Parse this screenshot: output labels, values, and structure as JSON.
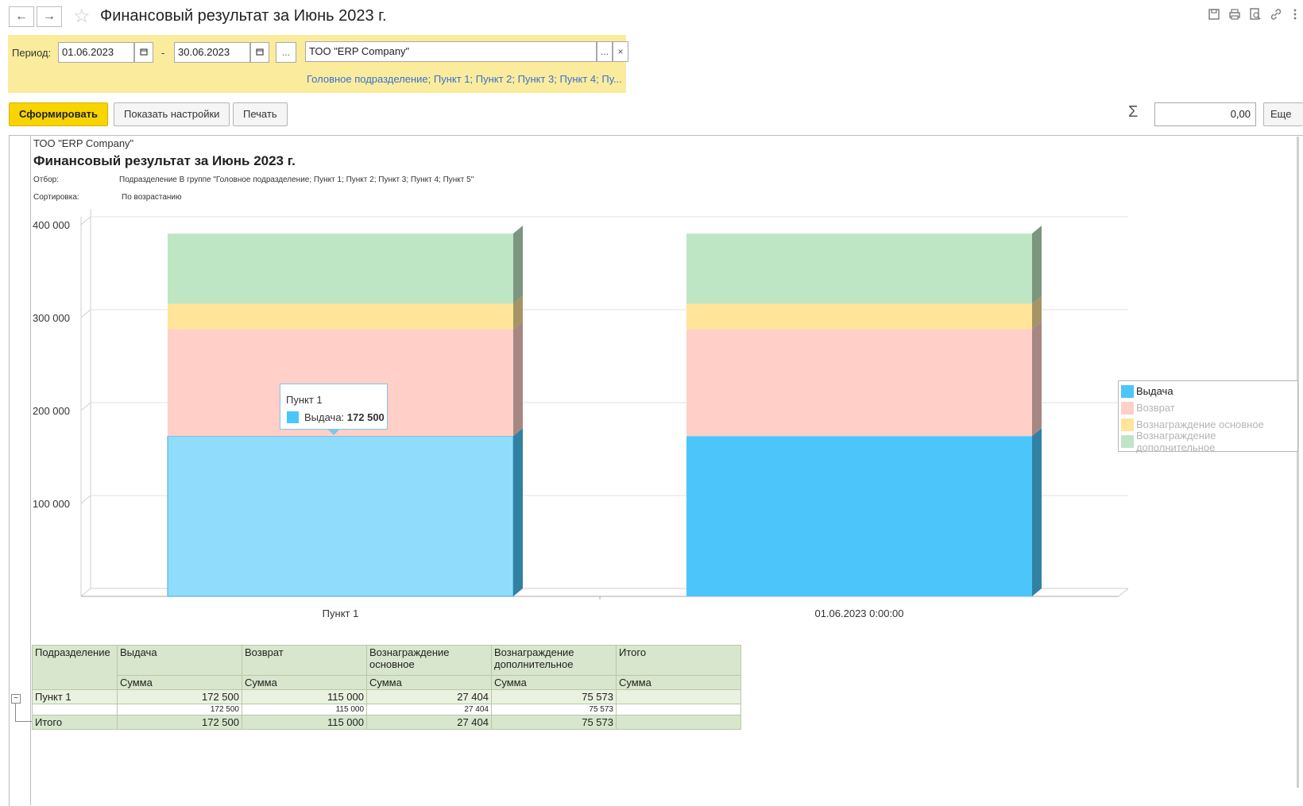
{
  "window": {
    "title": "Финансовый результат  за Июнь 2023 г.",
    "back_icon": "←",
    "forward_icon": "→",
    "favorite_icon": "☆"
  },
  "filter": {
    "period_label": "Период:",
    "date_from": "01.06.2023",
    "date_to": "30.06.2023",
    "dash": "-",
    "ellipsis": "...",
    "organization": "ТОО \"ERP Company\"",
    "clear": "×",
    "departments_link": "Головное подразделение; Пункт 1; Пункт 2; Пункт 3; Пункт 4; Пу..."
  },
  "toolbar": {
    "generate_label": "Сформировать",
    "settings_label": "Показать настройки",
    "print_label": "Печать",
    "sigma": "Σ",
    "sum_value": "0,00",
    "more_label": "Еще"
  },
  "report": {
    "company": "ТОО \"ERP Company\"",
    "title": "Финансовый результат  за Июнь 2023 г.",
    "filter_label": "Отбор:",
    "filter_value": "Подразделение В группе \"Головное подразделение; Пункт 1; Пункт 2; Пункт 3; Пункт 4; Пункт 5\"",
    "sort_label": "Сортировка:",
    "sort_value": "По возрастанию"
  },
  "chart_data": {
    "type": "bar",
    "stacked": true,
    "categories": [
      "Пункт 1",
      "01.06.2023 0:00:00"
    ],
    "series": [
      {
        "name": "Выдача",
        "values": [
          172500,
          172500
        ],
        "color": "#4cc6fa"
      },
      {
        "name": "Возврат",
        "values": [
          115000,
          115000
        ],
        "color": "#ffcfc8"
      },
      {
        "name": "Вознаграждение основное",
        "values": [
          27404,
          27404
        ],
        "color": "#ffe49a"
      },
      {
        "name": "Вознаграждение дополнительное",
        "values": [
          75573,
          75573
        ],
        "color": "#bfe6c4"
      }
    ],
    "y_ticks": [
      "100 000",
      "200 000",
      "300 000",
      "400 000"
    ],
    "ylim": [
      0,
      400000
    ],
    "grid": true,
    "legend": "right",
    "tooltip": {
      "title": "Пункт 1",
      "series": "Выдача:",
      "value": "172 500"
    }
  },
  "table": {
    "headers": [
      "Подразделение",
      "Выдача",
      "Возврат",
      "Вознаграждение основное",
      "Вознаграждение дополнительное",
      "Итого"
    ],
    "subheader": "Сумма",
    "rows": [
      {
        "name": "Пункт 1",
        "values": [
          "172 500",
          "115 000",
          "27 404",
          "75 573",
          ""
        ]
      },
      {
        "name": "",
        "values": [
          "172 500",
          "115 000",
          "27 404",
          "75 573",
          ""
        ]
      },
      {
        "name": "Итого",
        "values": [
          "172 500",
          "115 000",
          "27 404",
          "75 573",
          ""
        ]
      }
    ],
    "collapse_icon": "−"
  }
}
